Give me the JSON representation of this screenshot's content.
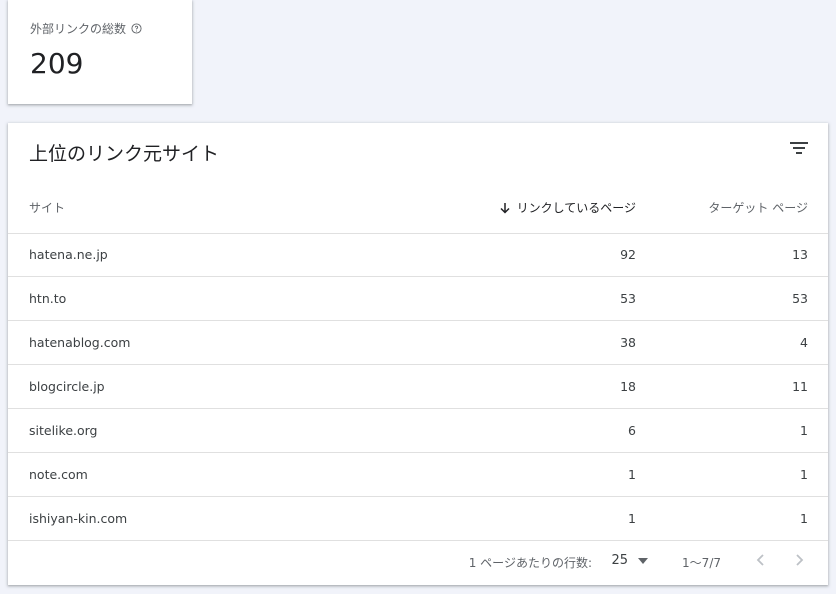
{
  "stat_card": {
    "label": "外部リンクの総数",
    "value": "209"
  },
  "top_sites": {
    "title": "上位のリンク元サイト",
    "columns": {
      "site": "サイト",
      "linking_pages": "リンクしているページ",
      "target_pages": "ターゲット ページ"
    },
    "rows": [
      {
        "site": "hatena.ne.jp",
        "linking_pages": "92",
        "target_pages": "13"
      },
      {
        "site": "htn.to",
        "linking_pages": "53",
        "target_pages": "53"
      },
      {
        "site": "hatenablog.com",
        "linking_pages": "38",
        "target_pages": "4"
      },
      {
        "site": "blogcircle.jp",
        "linking_pages": "18",
        "target_pages": "11"
      },
      {
        "site": "sitelike.org",
        "linking_pages": "6",
        "target_pages": "1"
      },
      {
        "site": "note.com",
        "linking_pages": "1",
        "target_pages": "1"
      },
      {
        "site": "ishiyan-kin.com",
        "linking_pages": "1",
        "target_pages": "1"
      }
    ],
    "footer": {
      "rows_per_page_label": "1 ページあたりの行数:",
      "rows_per_page_value": "25",
      "range": "1〜7/7"
    }
  },
  "icons": {
    "help": "help-circle-icon",
    "filter": "filter-icon",
    "sort": "arrow-down-icon",
    "dropdown": "caret-down-icon",
    "prev": "chevron-left-icon",
    "next": "chevron-right-icon"
  }
}
